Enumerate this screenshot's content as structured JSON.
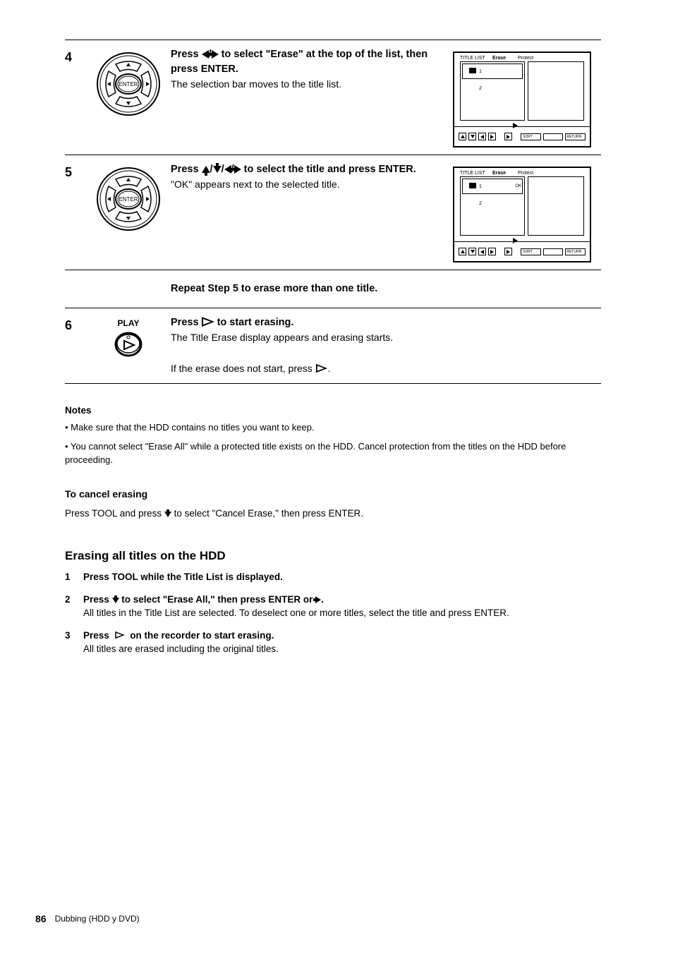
{
  "steps": {
    "s4": {
      "num": "4",
      "line1_pre": "Press ",
      "line1_post": " to select \"Erase\" at the top of the list, then press ENTER.",
      "line2": "The selection bar moves to the title list."
    },
    "s5": {
      "num": "5",
      "line1_pre": "Press ",
      "line1_post": " to select the title and press ENTER.",
      "line2": "\"OK\" appears next to the selected title."
    },
    "repeat": "Repeat Step 5 to erase more than one title.",
    "s6": {
      "num": "6",
      "line1_pre": "Press ",
      "line1_mid": " ",
      "line1_post": "to start erasing.",
      "line2": "The Title Erase display appears and erasing starts.",
      "line3_pre": "If the erase does not start, press ",
      "line3_post": "."
    }
  },
  "tv": {
    "s4": {
      "title": "TITLE LIST",
      "item1": "1",
      "item2": "2",
      "sublabel": "Protect",
      "highlight": "Erase"
    },
    "s5": {
      "title": "TITLE LIST",
      "item1": "1",
      "item2": "2",
      "sublabel": "Protect",
      "highlight": "Erase",
      "ok": "OK"
    },
    "bottom": {
      "b1": "SORT",
      "b2": "",
      "b3": "RETURN"
    }
  },
  "notes": {
    "h": "Notes",
    "p1": "• Make sure that the HDD contains no titles you want to keep.",
    "p2": "• You cannot select \"Erase All\" while a protected title exists on the HDD. Cancel protection from the titles on the HDD before proceeding."
  },
  "cancel": {
    "h1": "To cancel erasing",
    "t1_pre": "Press TOOL and press ",
    "t1_post": " to select \"Cancel Erase,\" then press ENTER."
  },
  "erase_all": {
    "h": "Erasing all titles on the HDD",
    "s1": {
      "n": "1",
      "t": "Press TOOL while the Title List is displayed."
    },
    "s2": {
      "n": "2",
      "t_pre": "Press ",
      "t_mid": " to select \"Erase All,\" then press ENTER or ",
      "t_post": ".",
      "t2": "All titles in the Title List are selected. To deselect one or more titles, select the title and press ENTER."
    },
    "s3": {
      "n": "3",
      "t_pre": "Press ",
      "t_post": " on the recorder to start erasing.",
      "t2": "All titles are erased including the original titles."
    }
  },
  "play_label": "PLAY",
  "footer": {
    "page": "86",
    "text": "Dubbing (HDD y DVD)"
  }
}
